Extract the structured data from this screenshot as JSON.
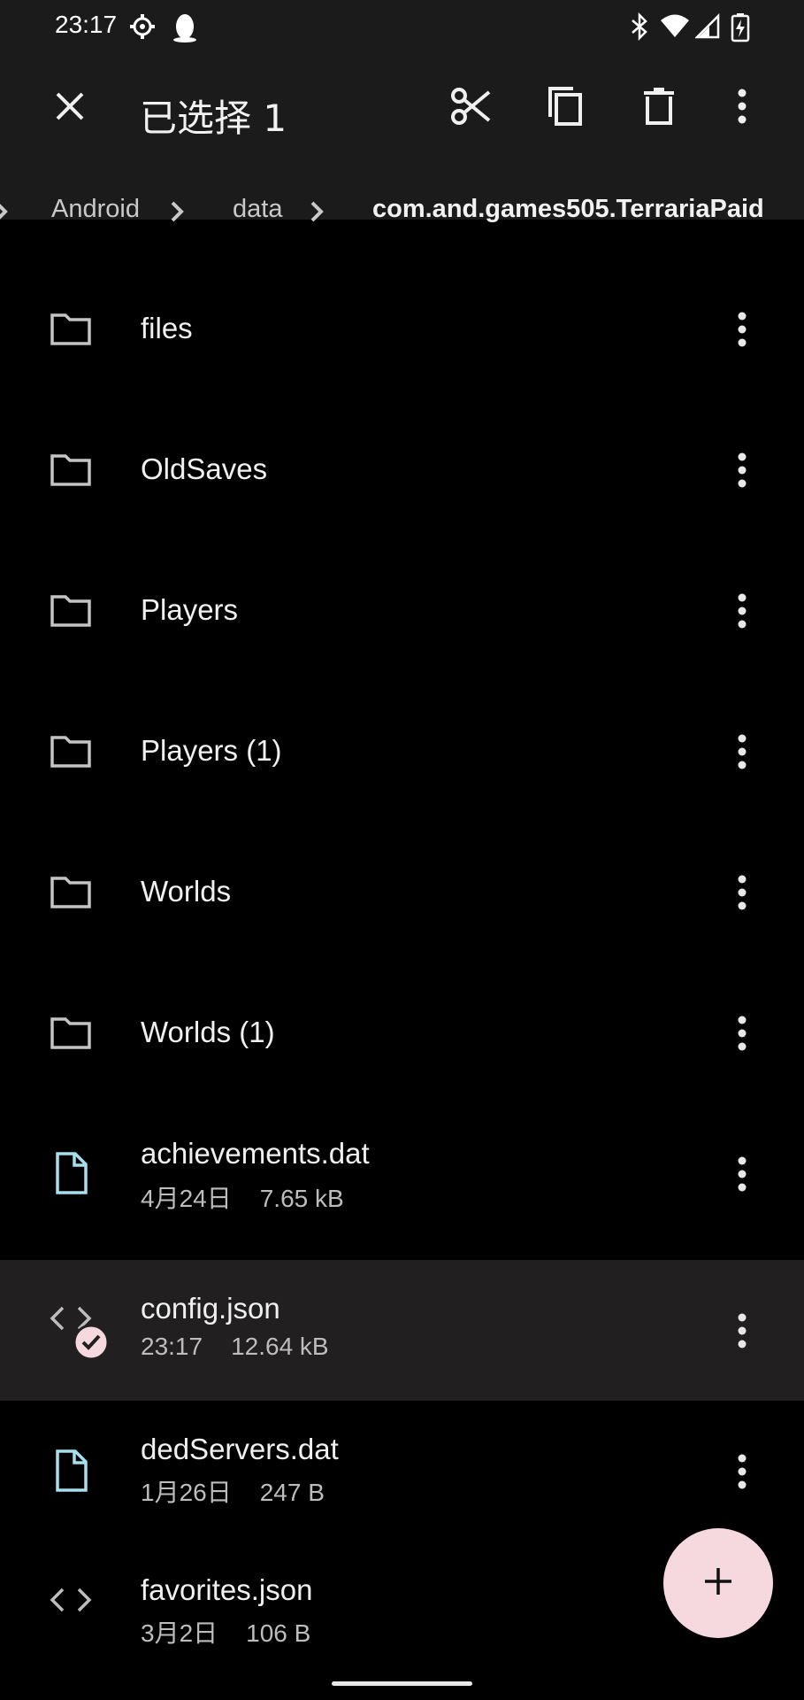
{
  "status_bar": {
    "time": "23:17",
    "icons": [
      "settings-gear-icon",
      "qq-penguin-icon",
      "bluetooth-icon",
      "wifi-icon",
      "signal-icon",
      "battery-charging-icon"
    ]
  },
  "selection_bar": {
    "title": "已选择 1",
    "actions": [
      "close-icon",
      "cut-icon",
      "copy-icon",
      "delete-icon",
      "more-vert-icon"
    ]
  },
  "breadcrumb": {
    "items": [
      "Android",
      "data",
      "com.and.games505.TerrariaPaid"
    ]
  },
  "files": [
    {
      "name": "files",
      "type": "folder"
    },
    {
      "name": "OldSaves",
      "type": "folder"
    },
    {
      "name": "Players",
      "type": "folder"
    },
    {
      "name": "Players (1)",
      "type": "folder"
    },
    {
      "name": "Worlds",
      "type": "folder"
    },
    {
      "name": "Worlds (1)",
      "type": "folder"
    },
    {
      "name": "achievements.dat",
      "type": "file",
      "date": "4月24日",
      "size": "7.65 kB"
    },
    {
      "name": "config.json",
      "type": "code",
      "date": "23:17",
      "size": "12.64 kB",
      "selected": true
    },
    {
      "name": "dedServers.dat",
      "type": "file",
      "date": "1月26日",
      "size": "247 B"
    },
    {
      "name": "favorites.json",
      "type": "code",
      "date": "3月2日",
      "size": "106 B"
    }
  ],
  "fab": {
    "icon": "add-icon"
  },
  "colors": {
    "bar_bg": "#1b1b1b",
    "background": "#000000",
    "selected_row": "#211f1f",
    "file_icon": "#a6e0f0",
    "fab_bg": "#f6d9df"
  }
}
